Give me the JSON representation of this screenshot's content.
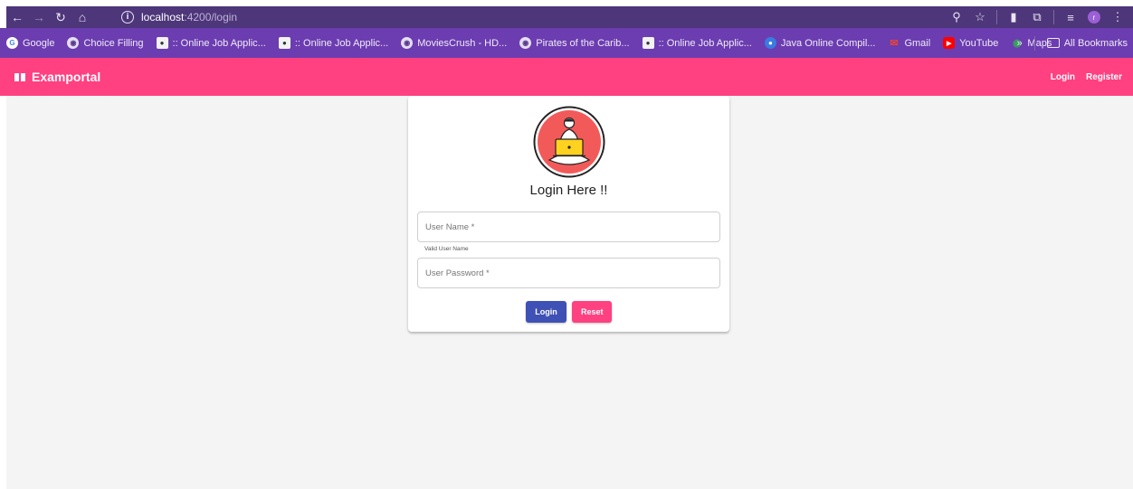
{
  "browser": {
    "url_host": "localhost",
    "url_path": ":4200/login",
    "nav_icons": [
      "back-arrow-icon",
      "forward-arrow-icon",
      "reload-icon",
      "home-icon"
    ],
    "colors": {
      "address_bar": "#4d3679",
      "bookmarks_bar": "#6b3db0"
    }
  },
  "bookmarks": {
    "items": [
      {
        "label": "Google",
        "icon": "google-icon"
      },
      {
        "label": "Choice Filling",
        "icon": "globe-icon"
      },
      {
        "label": ":: Online Job Applic...",
        "icon": "job-portal-icon"
      },
      {
        "label": ":: Online Job Applic...",
        "icon": "job-portal-icon"
      },
      {
        "label": "MoviesCrush - HD...",
        "icon": "globe-icon"
      },
      {
        "label": "Pirates of the Carib...",
        "icon": "globe-icon"
      },
      {
        "label": ":: Online Job Applic...",
        "icon": "job-portal-icon"
      },
      {
        "label": "Java Online Compil...",
        "icon": "java-compiler-icon"
      },
      {
        "label": "Gmail",
        "icon": "gmail-icon"
      },
      {
        "label": "YouTube",
        "icon": "youtube-icon"
      },
      {
        "label": "Maps",
        "icon": "maps-icon"
      }
    ],
    "more": "»",
    "all_bookmarks": "All Bookmarks"
  },
  "app": {
    "brand": "Examportal",
    "brand_icon": "book-icon",
    "nav": {
      "login": "Login",
      "register": "Register"
    },
    "colors": {
      "toolbar": "#ff4081",
      "primary": "#3f51b5",
      "accent": "#ff4081"
    }
  },
  "login_card": {
    "title": "Login Here !!",
    "username_placeholder": "User Name *",
    "username_hint": "Valid User Name",
    "password_placeholder": "User Password *",
    "login_button": "Login",
    "reset_button": "Reset"
  }
}
